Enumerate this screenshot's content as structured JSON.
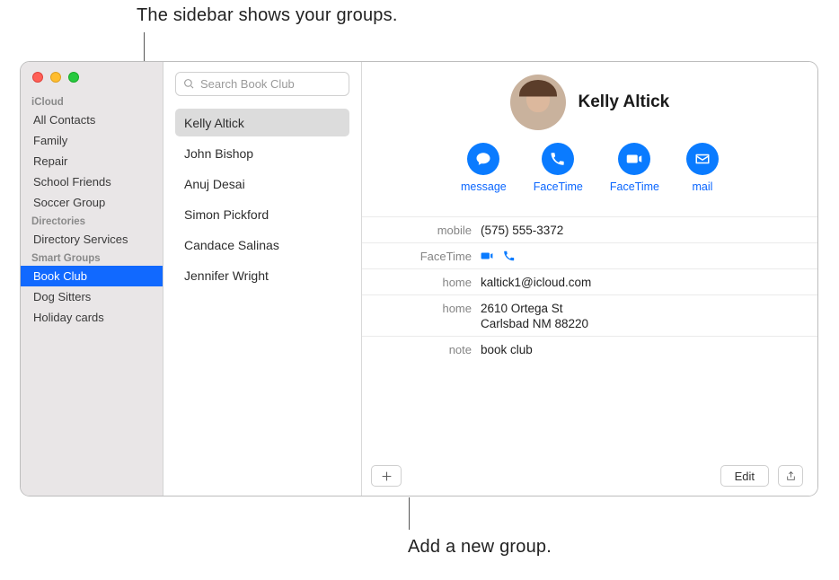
{
  "callouts": {
    "top": "The sidebar shows your groups.",
    "bottom": "Add a new group."
  },
  "sidebar": {
    "sections": [
      {
        "header": "iCloud",
        "items": [
          {
            "label": "All Contacts",
            "selected": false
          },
          {
            "label": "Family",
            "selected": false
          },
          {
            "label": "Repair",
            "selected": false
          },
          {
            "label": "School Friends",
            "selected": false
          },
          {
            "label": "Soccer Group",
            "selected": false
          }
        ]
      },
      {
        "header": "Directories",
        "items": [
          {
            "label": "Directory Services",
            "selected": false
          }
        ]
      },
      {
        "header": "Smart Groups",
        "items": [
          {
            "label": "Book Club",
            "selected": true
          },
          {
            "label": "Dog Sitters",
            "selected": false
          },
          {
            "label": "Holiday cards",
            "selected": false
          }
        ]
      }
    ]
  },
  "search": {
    "placeholder": "Search Book Club"
  },
  "contacts": [
    {
      "name": "Kelly Altick",
      "selected": true
    },
    {
      "name": "John Bishop",
      "selected": false
    },
    {
      "name": "Anuj Desai",
      "selected": false
    },
    {
      "name": "Simon Pickford",
      "selected": false
    },
    {
      "name": "Candace Salinas",
      "selected": false
    },
    {
      "name": "Jennifer Wright",
      "selected": false
    }
  ],
  "detail": {
    "name": "Kelly Altick",
    "actions": [
      {
        "id": "message",
        "label": "message",
        "icon": "message-icon"
      },
      {
        "id": "facetime-audio",
        "label": "FaceTime",
        "icon": "phone-icon"
      },
      {
        "id": "facetime-video",
        "label": "FaceTime",
        "icon": "video-icon"
      },
      {
        "id": "mail",
        "label": "mail",
        "icon": "mail-icon"
      }
    ],
    "fields": {
      "mobile_label": "mobile",
      "mobile_value": "(575) 555-3372",
      "facetime_label": "FaceTime",
      "email_label": "home",
      "email_value": "kaltick1@icloud.com",
      "address_label": "home",
      "address_line1": "2610 Ortega St",
      "address_line2": "Carlsbad NM 88220",
      "note_label": "note",
      "note_value": "book club"
    },
    "buttons": {
      "edit": "Edit"
    }
  }
}
